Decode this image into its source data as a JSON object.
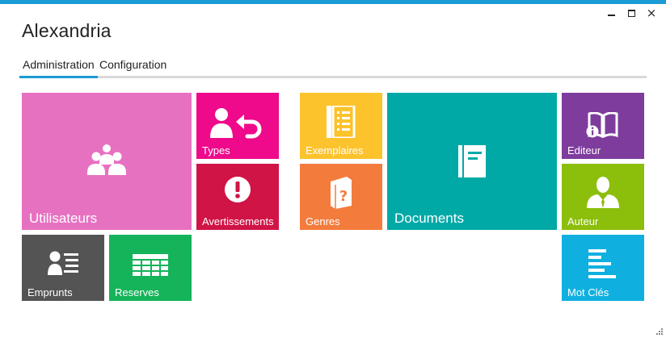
{
  "window": {
    "title": "Alexandria",
    "accent_color": "#1a9bd4",
    "controls": {
      "minimize": "minimize-icon",
      "maximize": "maximize-icon",
      "close": "×"
    }
  },
  "tabs": [
    {
      "label": "Administration",
      "selected": true
    },
    {
      "label": "Configuration",
      "selected": false
    }
  ],
  "tiles": {
    "utilisateurs": {
      "label": "Utilisateurs",
      "color": "#e771c1",
      "icon": "users-group-icon"
    },
    "types": {
      "label": "Types",
      "color": "#ee0a8b",
      "icon": "user-return-icon"
    },
    "avertissements": {
      "label": "Avertissements",
      "color": "#d01446",
      "icon": "exclamation-icon"
    },
    "exemplaires": {
      "label": "Exemplaires",
      "color": "#fcc32c",
      "icon": "list-document-icon"
    },
    "genres": {
      "label": "Genres",
      "color": "#f37c3d",
      "icon": "question-book-icon"
    },
    "documents": {
      "label": "Documents",
      "color": "#00a9a6",
      "icon": "document-book-icon"
    },
    "editeur": {
      "label": "Editeur",
      "color": "#7e3c9d",
      "icon": "book-info-icon"
    },
    "auteur": {
      "label": "Auteur",
      "color": "#8cbe0c",
      "icon": "author-icon"
    },
    "emprunts": {
      "label": "Emprunts",
      "color": "#545454",
      "icon": "user-list-icon"
    },
    "reserves": {
      "label": "Reserves",
      "color": "#15b35a",
      "icon": "table-grid-icon"
    },
    "motcles": {
      "label": "Mot Clés",
      "color": "#0fb0e0",
      "icon": "text-lines-icon"
    }
  }
}
